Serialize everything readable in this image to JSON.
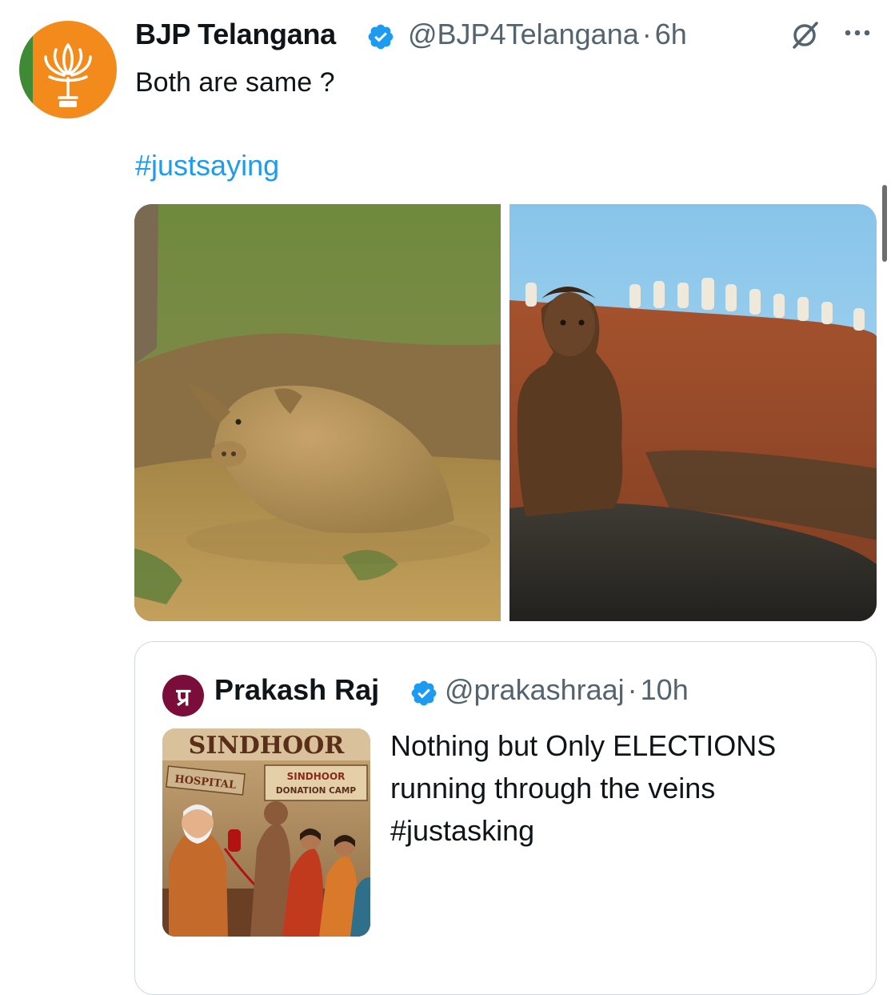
{
  "tweet": {
    "author_name": "BJP Telangana",
    "author_handle": "@BJP4Telangana",
    "separator": "·",
    "time": "6h",
    "verified": true,
    "text": "Both are same ?",
    "hashtag": "#justsaying",
    "grok_icon": "grok-icon",
    "more_icon": "more-icon",
    "avatar_icon": "lotus-icon"
  },
  "quoted_tweet": {
    "author_name": "Prakash Raj",
    "author_handle": "@prakashraaj",
    "separator": "·",
    "time": "10h",
    "verified": true,
    "avatar_text": "प्र",
    "text_lines": [
      "Nothing but Only  ELECTIONS",
      "running through the veins",
      "#justasking"
    ],
    "thumbnail": {
      "title": "SINDHOOR",
      "sign_left": "HOSPITAL",
      "sign_right_1": "SINDHOOR",
      "sign_right_2": "DONATION CAMP"
    }
  },
  "colors": {
    "text": "#0f1419",
    "secondary": "#536471",
    "link": "#1d9bf0",
    "verified": "#1d9bf0",
    "border": "#cfd9de",
    "bjp_orange": "#f28b1b",
    "bjp_green": "#3f8a34"
  }
}
